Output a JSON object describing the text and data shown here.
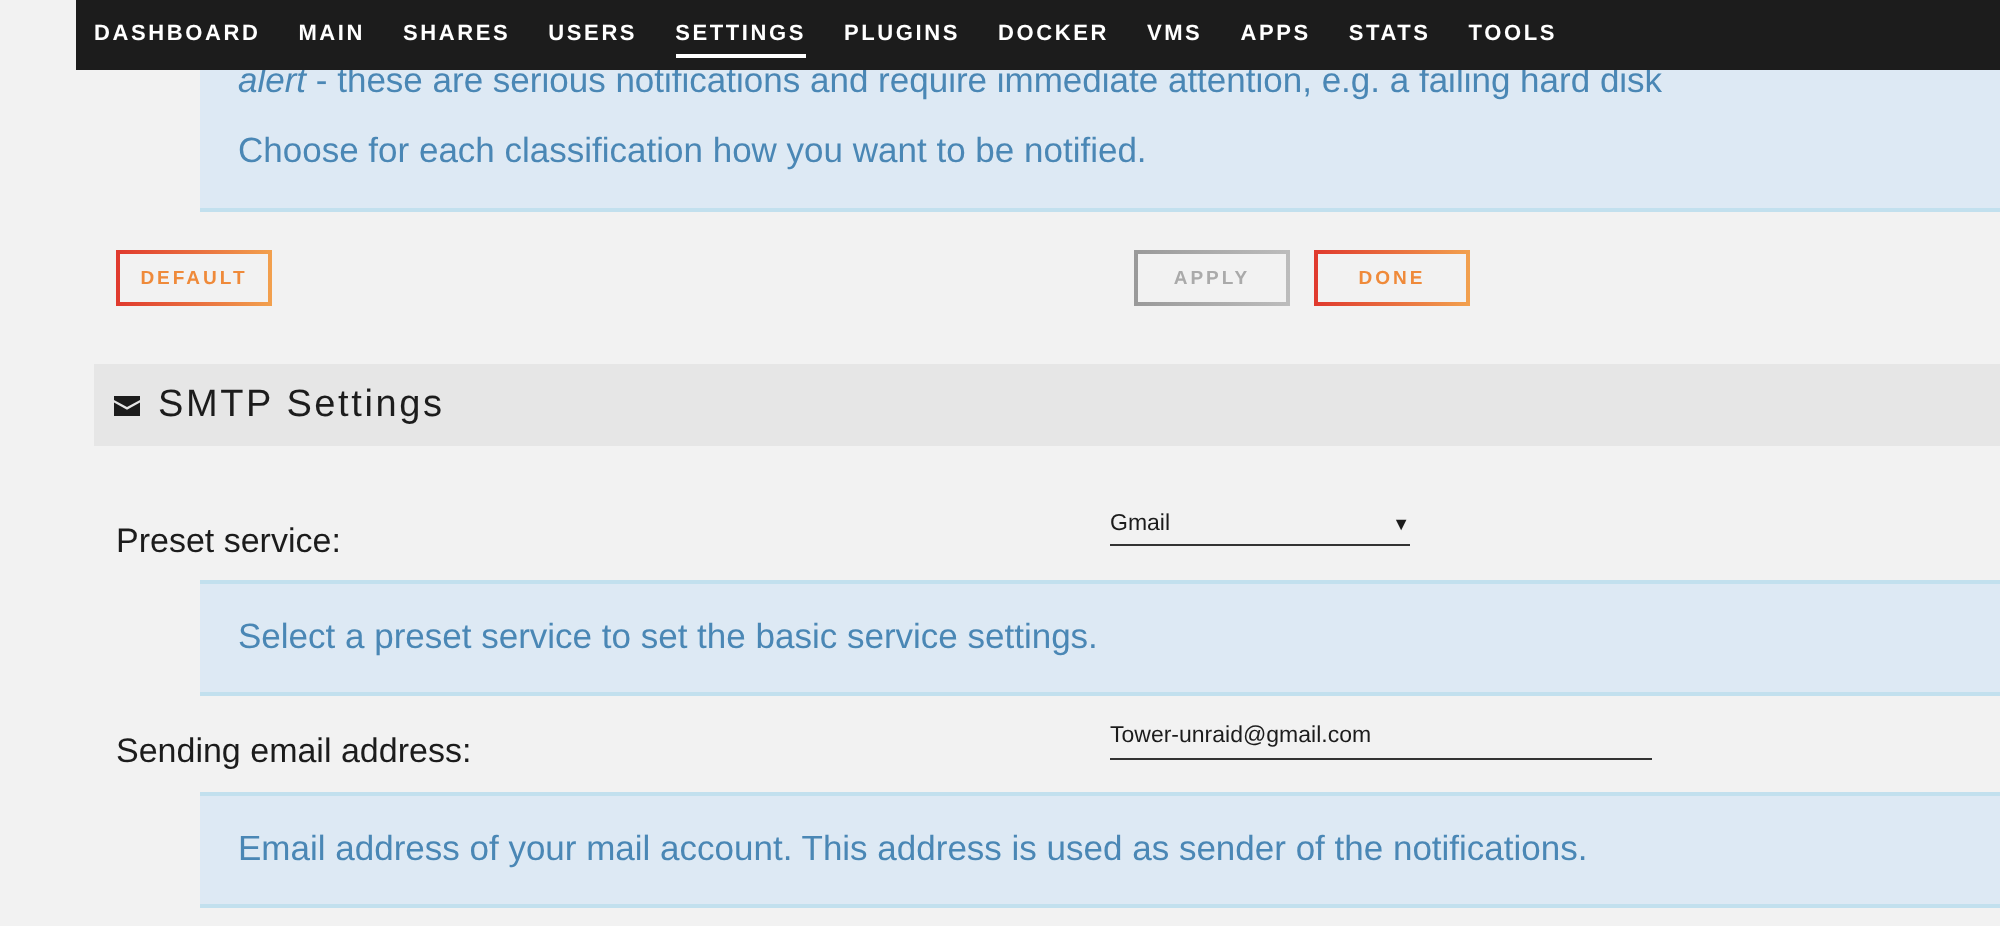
{
  "nav": {
    "items": [
      {
        "label": "DASHBOARD",
        "selected": false
      },
      {
        "label": "MAIN",
        "selected": false
      },
      {
        "label": "SHARES",
        "selected": false
      },
      {
        "label": "USERS",
        "selected": false
      },
      {
        "label": "SETTINGS",
        "selected": true
      },
      {
        "label": "PLUGINS",
        "selected": false
      },
      {
        "label": "DOCKER",
        "selected": false
      },
      {
        "label": "VMS",
        "selected": false
      },
      {
        "label": "APPS",
        "selected": false
      },
      {
        "label": "STATS",
        "selected": false
      },
      {
        "label": "TOOLS",
        "selected": false
      }
    ]
  },
  "notice": {
    "lines": [
      "*alert* - these are serious notifications and require immediate attention, e.g. a failing hard disk",
      "Choose for each classification how you want to be notified."
    ]
  },
  "buttons": [
    {
      "label": "DEFAULT",
      "disabled": false
    },
    {
      "label": "APPLY",
      "disabled": true
    },
    {
      "label": "DONE",
      "disabled": false
    }
  ],
  "section": {
    "title": "SMTP Settings"
  },
  "fields": [
    {
      "label": "Preset service:",
      "kind": "select",
      "value": "Gmail",
      "caret": "▼",
      "help": "Select a preset service to set the basic service settings."
    },
    {
      "label": "Sending email address:",
      "kind": "text",
      "value": "Tower-unraid@gmail.com",
      "help": "Email address of your mail account. This address is used as sender of the notifications."
    }
  ]
}
